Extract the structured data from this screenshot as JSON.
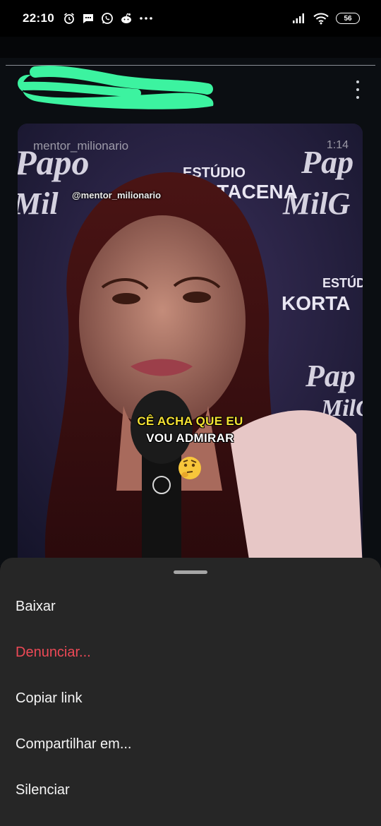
{
  "status_bar": {
    "time": "22:10",
    "battery": "56",
    "icons": [
      "alarm-icon",
      "message-icon",
      "whatsapp-icon",
      "reddit-icon",
      "more-dots-icon",
      "signal-icon",
      "wifi-icon",
      "battery-icon"
    ]
  },
  "post": {
    "options_icon": "more-vertical-icon"
  },
  "video": {
    "handle": "mentor_milionario",
    "duration": "1:14",
    "watermark": "@mentor_milionario",
    "caption_line1": "CÊ ACHA QUE EU",
    "caption_line2": "VOU ADMIRAR",
    "background_text": [
      "Papo",
      "MilG",
      "ESTÚDIO",
      "KORTACENA"
    ]
  },
  "sheet": {
    "items": [
      {
        "label": "Baixar"
      },
      {
        "label": "Denunciar..."
      },
      {
        "label": "Copiar link"
      },
      {
        "label": "Compartilhar em..."
      },
      {
        "label": "Silenciar"
      }
    ],
    "danger_color": "#ed4956",
    "background_color": "#262626"
  }
}
